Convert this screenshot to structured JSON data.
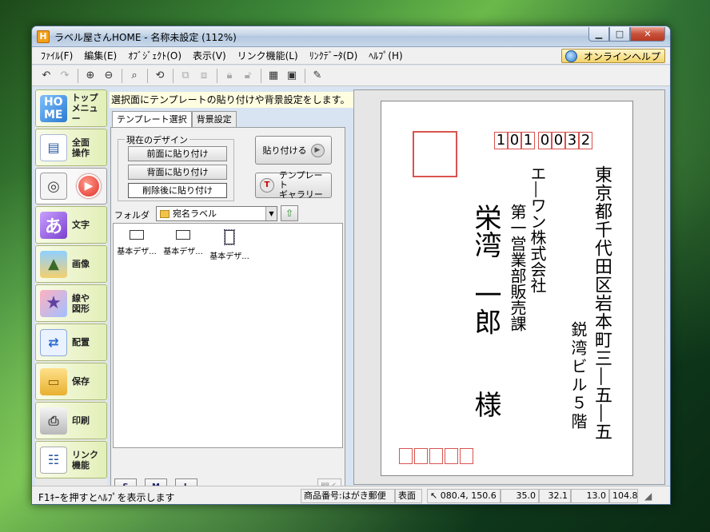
{
  "window": {
    "title": "ラベル屋さんHOME - 名称未設定 (112%)"
  },
  "menu": [
    "ﾌｧｲﾙ(F)",
    "編集(E)",
    "ｵﾌﾞｼﾞｪｸﾄ(O)",
    "表示(V)",
    "リンク機能(L)",
    "ﾘﾝｸﾃﾞｰﾀ(D)",
    "ﾍﾙﾌﾟ(H)"
  ],
  "help_online": "オンラインヘルプ",
  "sidebar": [
    {
      "label": "トップ\nメニュー",
      "icon": "home-icon"
    },
    {
      "label": "全面\n操作",
      "icon": "full-operation-icon"
    },
    {
      "label": "",
      "icon": "template-cd-icon"
    },
    {
      "label": "文字",
      "icon": "text-icon"
    },
    {
      "label": "画像",
      "icon": "image-icon"
    },
    {
      "label": "線や\n図形",
      "icon": "shape-icon"
    },
    {
      "label": "配置",
      "icon": "layout-icon"
    },
    {
      "label": "保存",
      "icon": "save-icon"
    },
    {
      "label": "印刷",
      "icon": "print-icon"
    },
    {
      "label": "リンク\n機能",
      "icon": "link-icon"
    }
  ],
  "hint": "選択面にテンプレートの貼り付けや背景設定をします。",
  "tabs": {
    "template": "テンプレート選択",
    "background": "背景設定"
  },
  "group": {
    "title": "現在のデザイン",
    "front": "前面に貼り付け",
    "back": "背面に貼り付け",
    "replace": "削除後に貼り付け"
  },
  "apply": "貼り付ける",
  "gallery": "テンプレート\nギャラリー",
  "folder": {
    "label": "フォルダ",
    "value": "宛名ラベル"
  },
  "templates": [
    "基本デザ...",
    "基本デザ...",
    "基本デザ..."
  ],
  "view_buttons": [
    "S",
    "M",
    "L"
  ],
  "open": "開く",
  "postcard": {
    "zip": [
      "1",
      "0",
      "1",
      "0",
      "0",
      "3",
      "2"
    ],
    "address1": "東京都千代田区岩本町三―五―五",
    "address2": "鋭湾ビル５階",
    "company": "エ―ワン株式会社",
    "dept": "第一営業部販売課",
    "name1": "栄湾",
    "name2": "一郎",
    "honorific": "様"
  },
  "status": {
    "help": "F1ｷｰを押すとﾍﾙﾌﾟを表示します",
    "product": "商品番号:はがき郵便",
    "face": "表面",
    "pos": "080.4, 150.6",
    "size1": "35.0",
    "size2": "32.1",
    "size3": "13.0",
    "size4": "104.8"
  }
}
